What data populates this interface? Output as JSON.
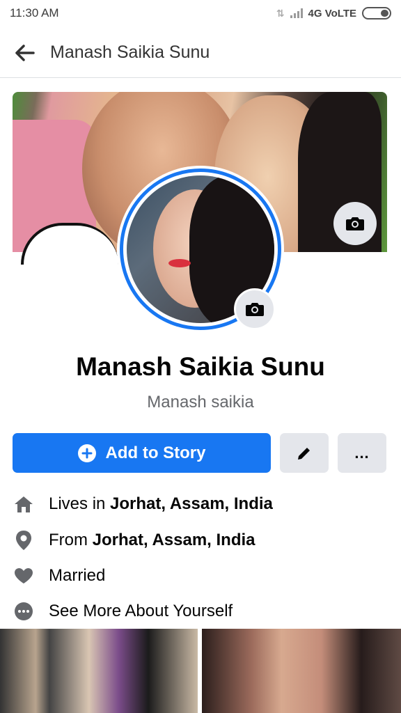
{
  "status_bar": {
    "time": "11:30 AM",
    "network": "4G VoLTE"
  },
  "nav": {
    "title": "Manash Saikia Sunu",
    "back_icon": "arrow-left-icon"
  },
  "profile": {
    "name": "Manash Saikia Sunu",
    "alternate_name": "Manash saikia"
  },
  "actions": {
    "add_story_label": "Add to Story",
    "more_label": "...",
    "primary_color": "#1877f2"
  },
  "details": [
    {
      "icon": "home-icon",
      "prefix": "Lives in ",
      "bold": "Jorhat, Assam, India"
    },
    {
      "icon": "location-pin-icon",
      "prefix": "From ",
      "bold": "Jorhat, Assam, India"
    },
    {
      "icon": "heart-icon",
      "prefix": "Married",
      "bold": ""
    },
    {
      "icon": "more-dots-icon",
      "prefix": "See More About Yourself",
      "bold": ""
    }
  ]
}
